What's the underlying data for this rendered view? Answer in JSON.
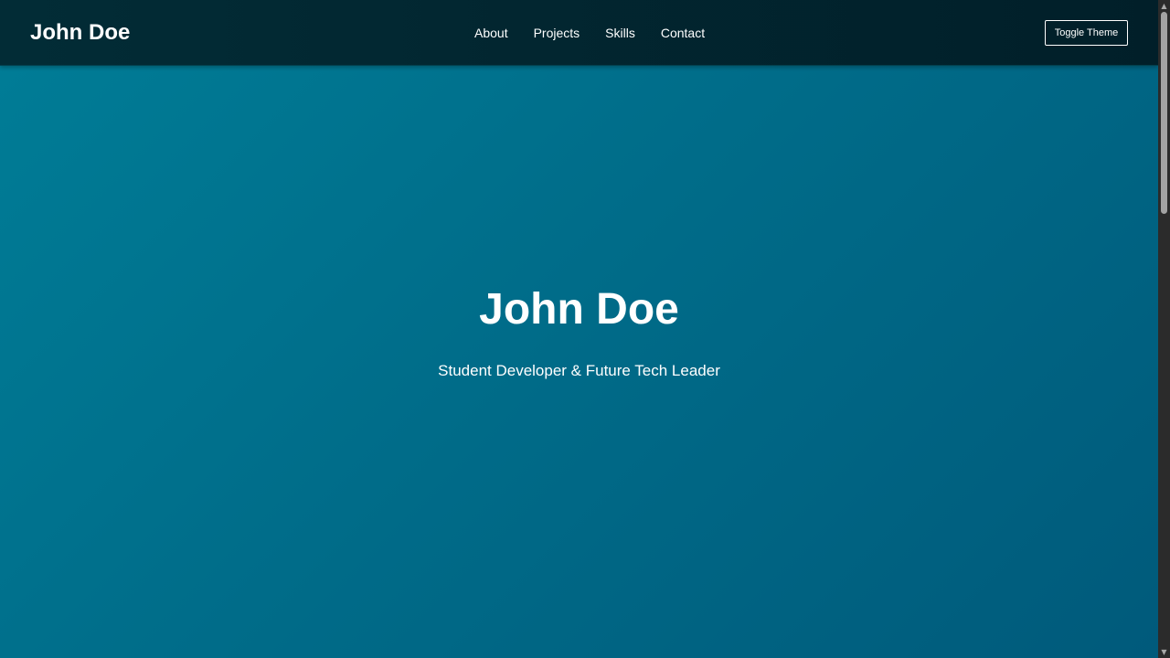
{
  "header": {
    "brand": "John Doe",
    "nav": [
      {
        "label": "About"
      },
      {
        "label": "Projects"
      },
      {
        "label": "Skills"
      },
      {
        "label": "Contact"
      }
    ],
    "theme_toggle_label": "Toggle Theme"
  },
  "hero": {
    "title": "John Doe",
    "subtitle": "Student Developer & Future Tech Leader"
  },
  "scrollbar": {
    "up_icon": "scroll-up-arrow",
    "down_icon": "scroll-down-arrow"
  },
  "colors": {
    "navbar": "#01242e",
    "hero_start": "#007c96",
    "hero_end": "#005a7b",
    "text": "#ffffff"
  }
}
